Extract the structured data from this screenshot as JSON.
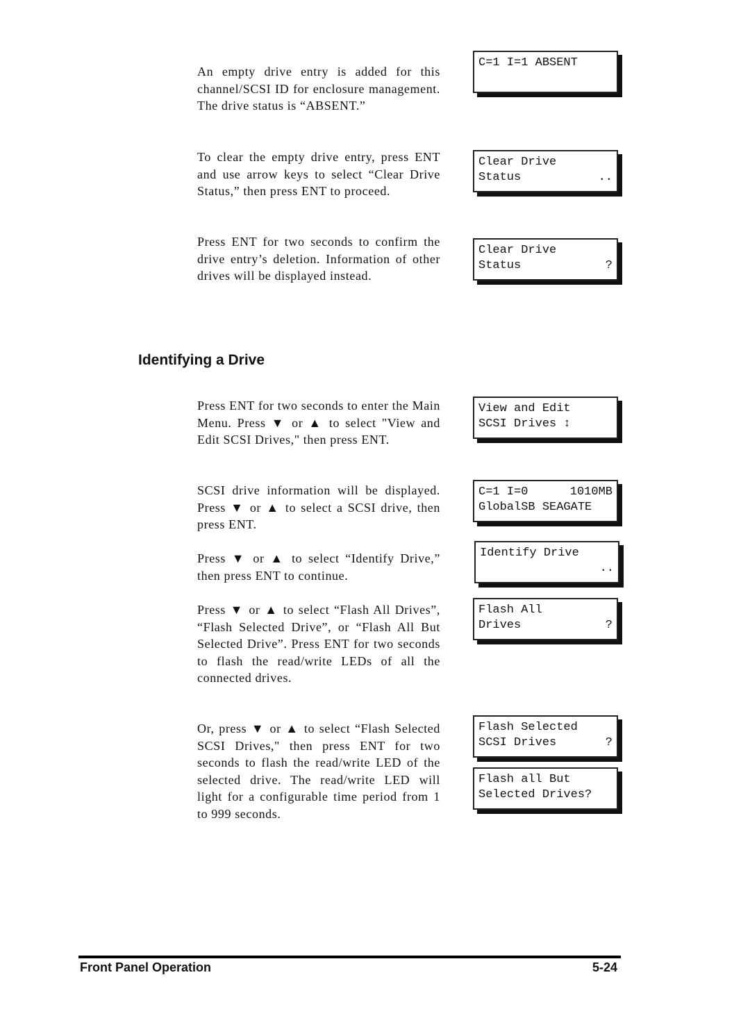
{
  "paragraphs": [
    "An empty drive entry is added for this channel/SCSI ID for enclosure management. The drive status is “ABSENT.”",
    "To clear the empty drive entry, press ENT and use arrow keys to select “Clear Drive Status,” then press ENT to proceed.",
    "Press ENT for two seconds to confirm the drive entry’s deletion. Information of other drives will be displayed instead.",
    "Press ENT for two seconds to enter the Main Menu. Press ▼ or ▲ to select \"View and Edit SCSI Drives,\" then press ENT.",
    "SCSI drive information will be displayed. Press ▼ or ▲ to select a SCSI drive, then press ENT.",
    "Press ▼ or ▲ to select “Identify Drive,” then press ENT to continue.",
    "Press ▼ or ▲ to select “Flash All Drives”, “Flash Selected Drive”, or “Flash All But Selected Drive”. Press ENT for two seconds to flash the read/write LEDs of all the connected drives.",
    "Or, press ▼ or ▲ to select “Flash Selected SCSI Drives,\" then press ENT for two seconds to flash the read/write LED of the selected drive. The read/write LED will light for a configurable time period from 1 to 999 seconds."
  ],
  "section_heading": "Identifying a Drive",
  "lcd_screens": [
    {
      "lines": [
        {
          "l": "C=1 I=1 ABSENT",
          "r": ""
        },
        {
          "l": "",
          "r": ""
        }
      ]
    },
    {
      "lines": [
        {
          "l": "Clear Drive",
          "r": ""
        },
        {
          "l": "Status",
          "r": ".."
        }
      ]
    },
    {
      "lines": [
        {
          "l": "Clear Drive",
          "r": ""
        },
        {
          "l": "Status",
          "r": "?"
        }
      ]
    },
    {
      "lines": [
        {
          "l": "View and Edit",
          "r": ""
        },
        {
          "l": "SCSI Drives ↕",
          "r": ""
        }
      ]
    },
    {
      "lines": [
        {
          "l": "C=1 I=0",
          "r": "1010MB"
        },
        {
          "l": "GlobalSB SEAGATE",
          "r": ""
        }
      ]
    },
    {
      "lines": [
        {
          "l": "Identify Drive",
          "r": ""
        },
        {
          "l": "",
          "r": ".."
        }
      ]
    },
    {
      "lines": [
        {
          "l": "Flash All",
          "r": ""
        },
        {
          "l": "Drives",
          "r": "?"
        }
      ]
    },
    {
      "lines": [
        {
          "l": "Flash Selected",
          "r": ""
        },
        {
          "l": "SCSI Drives",
          "r": "?"
        }
      ]
    },
    {
      "lines": [
        {
          "l": "Flash all But",
          "r": ""
        },
        {
          "l": "Selected Drives?",
          "r": ""
        }
      ]
    }
  ],
  "footer": {
    "section": "Front Panel Operation",
    "page": "5-24"
  }
}
